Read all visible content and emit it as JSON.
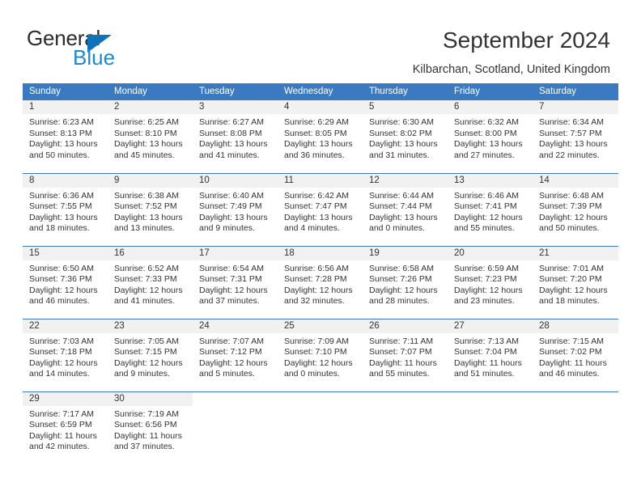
{
  "brand": {
    "name_part1": "General",
    "name_part2": "Blue",
    "triangle_color": "#1072bb",
    "blue_color": "#1b8bd0"
  },
  "header": {
    "title": "September 2024",
    "subtitle": "Kilbarchan, Scotland, United Kingdom"
  },
  "theme": {
    "header_blue": "#3b7ac1",
    "daynum_band": "#f1f1f1",
    "text": "#333333"
  },
  "calendar": {
    "weekday_headers": [
      "Sunday",
      "Monday",
      "Tuesday",
      "Wednesday",
      "Thursday",
      "Friday",
      "Saturday"
    ],
    "weeks": [
      [
        {
          "day": "1",
          "sunrise": "Sunrise: 6:23 AM",
          "sunset": "Sunset: 8:13 PM",
          "daylight1": "Daylight: 13 hours",
          "daylight2": "and 50 minutes."
        },
        {
          "day": "2",
          "sunrise": "Sunrise: 6:25 AM",
          "sunset": "Sunset: 8:10 PM",
          "daylight1": "Daylight: 13 hours",
          "daylight2": "and 45 minutes."
        },
        {
          "day": "3",
          "sunrise": "Sunrise: 6:27 AM",
          "sunset": "Sunset: 8:08 PM",
          "daylight1": "Daylight: 13 hours",
          "daylight2": "and 41 minutes."
        },
        {
          "day": "4",
          "sunrise": "Sunrise: 6:29 AM",
          "sunset": "Sunset: 8:05 PM",
          "daylight1": "Daylight: 13 hours",
          "daylight2": "and 36 minutes."
        },
        {
          "day": "5",
          "sunrise": "Sunrise: 6:30 AM",
          "sunset": "Sunset: 8:02 PM",
          "daylight1": "Daylight: 13 hours",
          "daylight2": "and 31 minutes."
        },
        {
          "day": "6",
          "sunrise": "Sunrise: 6:32 AM",
          "sunset": "Sunset: 8:00 PM",
          "daylight1": "Daylight: 13 hours",
          "daylight2": "and 27 minutes."
        },
        {
          "day": "7",
          "sunrise": "Sunrise: 6:34 AM",
          "sunset": "Sunset: 7:57 PM",
          "daylight1": "Daylight: 13 hours",
          "daylight2": "and 22 minutes."
        }
      ],
      [
        {
          "day": "8",
          "sunrise": "Sunrise: 6:36 AM",
          "sunset": "Sunset: 7:55 PM",
          "daylight1": "Daylight: 13 hours",
          "daylight2": "and 18 minutes."
        },
        {
          "day": "9",
          "sunrise": "Sunrise: 6:38 AM",
          "sunset": "Sunset: 7:52 PM",
          "daylight1": "Daylight: 13 hours",
          "daylight2": "and 13 minutes."
        },
        {
          "day": "10",
          "sunrise": "Sunrise: 6:40 AM",
          "sunset": "Sunset: 7:49 PM",
          "daylight1": "Daylight: 13 hours",
          "daylight2": "and 9 minutes."
        },
        {
          "day": "11",
          "sunrise": "Sunrise: 6:42 AM",
          "sunset": "Sunset: 7:47 PM",
          "daylight1": "Daylight: 13 hours",
          "daylight2": "and 4 minutes."
        },
        {
          "day": "12",
          "sunrise": "Sunrise: 6:44 AM",
          "sunset": "Sunset: 7:44 PM",
          "daylight1": "Daylight: 13 hours",
          "daylight2": "and 0 minutes."
        },
        {
          "day": "13",
          "sunrise": "Sunrise: 6:46 AM",
          "sunset": "Sunset: 7:41 PM",
          "daylight1": "Daylight: 12 hours",
          "daylight2": "and 55 minutes."
        },
        {
          "day": "14",
          "sunrise": "Sunrise: 6:48 AM",
          "sunset": "Sunset: 7:39 PM",
          "daylight1": "Daylight: 12 hours",
          "daylight2": "and 50 minutes."
        }
      ],
      [
        {
          "day": "15",
          "sunrise": "Sunrise: 6:50 AM",
          "sunset": "Sunset: 7:36 PM",
          "daylight1": "Daylight: 12 hours",
          "daylight2": "and 46 minutes."
        },
        {
          "day": "16",
          "sunrise": "Sunrise: 6:52 AM",
          "sunset": "Sunset: 7:33 PM",
          "daylight1": "Daylight: 12 hours",
          "daylight2": "and 41 minutes."
        },
        {
          "day": "17",
          "sunrise": "Sunrise: 6:54 AM",
          "sunset": "Sunset: 7:31 PM",
          "daylight1": "Daylight: 12 hours",
          "daylight2": "and 37 minutes."
        },
        {
          "day": "18",
          "sunrise": "Sunrise: 6:56 AM",
          "sunset": "Sunset: 7:28 PM",
          "daylight1": "Daylight: 12 hours",
          "daylight2": "and 32 minutes."
        },
        {
          "day": "19",
          "sunrise": "Sunrise: 6:58 AM",
          "sunset": "Sunset: 7:26 PM",
          "daylight1": "Daylight: 12 hours",
          "daylight2": "and 28 minutes."
        },
        {
          "day": "20",
          "sunrise": "Sunrise: 6:59 AM",
          "sunset": "Sunset: 7:23 PM",
          "daylight1": "Daylight: 12 hours",
          "daylight2": "and 23 minutes."
        },
        {
          "day": "21",
          "sunrise": "Sunrise: 7:01 AM",
          "sunset": "Sunset: 7:20 PM",
          "daylight1": "Daylight: 12 hours",
          "daylight2": "and 18 minutes."
        }
      ],
      [
        {
          "day": "22",
          "sunrise": "Sunrise: 7:03 AM",
          "sunset": "Sunset: 7:18 PM",
          "daylight1": "Daylight: 12 hours",
          "daylight2": "and 14 minutes."
        },
        {
          "day": "23",
          "sunrise": "Sunrise: 7:05 AM",
          "sunset": "Sunset: 7:15 PM",
          "daylight1": "Daylight: 12 hours",
          "daylight2": "and 9 minutes."
        },
        {
          "day": "24",
          "sunrise": "Sunrise: 7:07 AM",
          "sunset": "Sunset: 7:12 PM",
          "daylight1": "Daylight: 12 hours",
          "daylight2": "and 5 minutes."
        },
        {
          "day": "25",
          "sunrise": "Sunrise: 7:09 AM",
          "sunset": "Sunset: 7:10 PM",
          "daylight1": "Daylight: 12 hours",
          "daylight2": "and 0 minutes."
        },
        {
          "day": "26",
          "sunrise": "Sunrise: 7:11 AM",
          "sunset": "Sunset: 7:07 PM",
          "daylight1": "Daylight: 11 hours",
          "daylight2": "and 55 minutes."
        },
        {
          "day": "27",
          "sunrise": "Sunrise: 7:13 AM",
          "sunset": "Sunset: 7:04 PM",
          "daylight1": "Daylight: 11 hours",
          "daylight2": "and 51 minutes."
        },
        {
          "day": "28",
          "sunrise": "Sunrise: 7:15 AM",
          "sunset": "Sunset: 7:02 PM",
          "daylight1": "Daylight: 11 hours",
          "daylight2": "and 46 minutes."
        }
      ],
      [
        {
          "day": "29",
          "sunrise": "Sunrise: 7:17 AM",
          "sunset": "Sunset: 6:59 PM",
          "daylight1": "Daylight: 11 hours",
          "daylight2": "and 42 minutes."
        },
        {
          "day": "30",
          "sunrise": "Sunrise: 7:19 AM",
          "sunset": "Sunset: 6:56 PM",
          "daylight1": "Daylight: 11 hours",
          "daylight2": "and 37 minutes."
        },
        {
          "day": "",
          "sunrise": "",
          "sunset": "",
          "daylight1": "",
          "daylight2": ""
        },
        {
          "day": "",
          "sunrise": "",
          "sunset": "",
          "daylight1": "",
          "daylight2": ""
        },
        {
          "day": "",
          "sunrise": "",
          "sunset": "",
          "daylight1": "",
          "daylight2": ""
        },
        {
          "day": "",
          "sunrise": "",
          "sunset": "",
          "daylight1": "",
          "daylight2": ""
        },
        {
          "day": "",
          "sunrise": "",
          "sunset": "",
          "daylight1": "",
          "daylight2": ""
        }
      ]
    ]
  }
}
